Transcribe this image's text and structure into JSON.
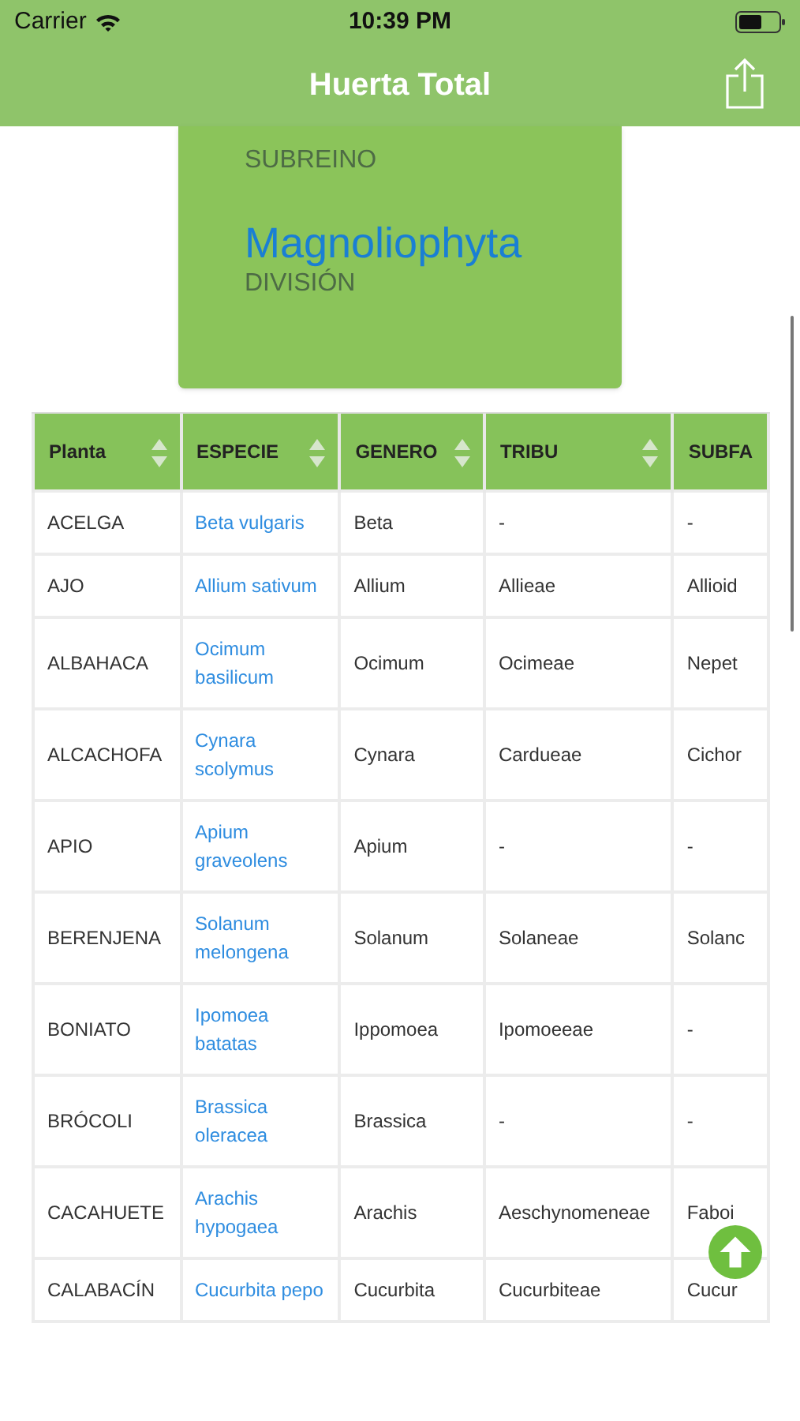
{
  "status_bar": {
    "carrier": "Carrier",
    "time": "10:39 PM"
  },
  "nav_bar": {
    "title": "Huerta Total"
  },
  "taxon_card": {
    "entries": [
      {
        "rank": "SUBREINO"
      },
      {
        "value": "Magnoliophyta",
        "rank": "DIVISIÓN"
      }
    ]
  },
  "table": {
    "columns": [
      {
        "label": "Planta",
        "sortable": true
      },
      {
        "label": "ESPECIE",
        "sortable": true
      },
      {
        "label": "GENERO",
        "sortable": true
      },
      {
        "label": "TRIBU",
        "sortable": true
      },
      {
        "label": "SUBFA",
        "sortable": false
      }
    ],
    "rows": [
      {
        "cells": [
          "ACELGA",
          "Beta vulgaris",
          "Beta",
          "-",
          "-"
        ]
      },
      {
        "cells": [
          "AJO",
          "Allium sativum",
          "Allium",
          "Allieae",
          "Allioid"
        ]
      },
      {
        "cells": [
          "ALBAHACA",
          "Ocimum basilicum",
          "Ocimum",
          "Ocimeae",
          "Nepet"
        ]
      },
      {
        "cells": [
          "ALCACHOFA",
          "Cynara scolymus",
          "Cynara",
          "Cardueae",
          "Cichor"
        ]
      },
      {
        "cells": [
          "APIO",
          "Apium graveolens",
          "Apium",
          "-",
          "-"
        ]
      },
      {
        "cells": [
          "BERENJENA",
          "Solanum melongena",
          "Solanum",
          "Solaneae",
          "Solanc"
        ]
      },
      {
        "cells": [
          "BONIATO",
          "Ipomoea batatas",
          "Ippomoea",
          "Ipomoeeae",
          "-"
        ]
      },
      {
        "cells": [
          "BRÓCOLI",
          "Brassica oleracea",
          "Brassica",
          "-",
          "-"
        ]
      },
      {
        "cells": [
          "CACAHUETE",
          "Arachis hypogaea",
          "Arachis",
          "Aeschynomeneae",
          "Faboi"
        ]
      },
      {
        "cells": [
          "CALABACÍN",
          "Cucurbita pepo",
          "Cucurbita",
          "Cucurbiteae",
          "Cucur"
        ]
      }
    ]
  }
}
